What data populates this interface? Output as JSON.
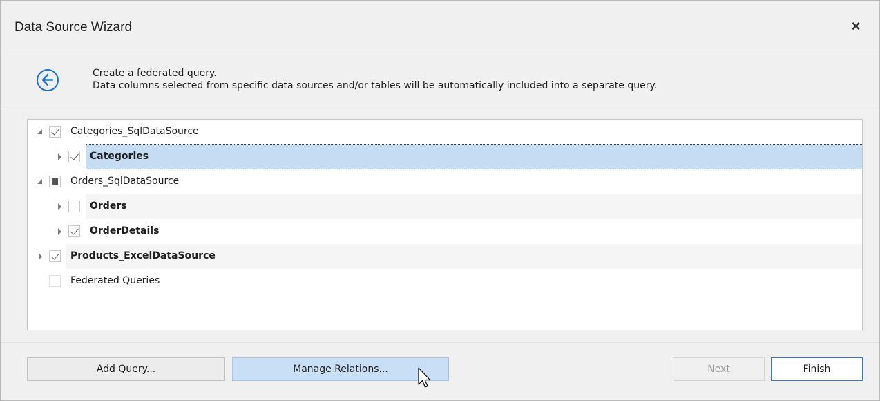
{
  "window": {
    "title": "Data Source Wizard",
    "close_glyph": "×"
  },
  "header": {
    "back_icon": "back-arrow-circle-icon",
    "accent_color": "#1a73d6",
    "line1": "Create a federated query.",
    "line2": "Data columns selected from specific data sources and/or tables will be automatically included into a separate query."
  },
  "tree": {
    "rows": [
      {
        "label": "Categories_SqlDataSource",
        "level": 0,
        "expander": "expanded",
        "check": "checked",
        "bold": false,
        "selected": false
      },
      {
        "label": "Categories",
        "level": 1,
        "expander": "collapsed",
        "check": "checked",
        "bold": true,
        "selected": true
      },
      {
        "label": "Orders_SqlDataSource",
        "level": 0,
        "expander": "expanded",
        "check": "indeterminate",
        "bold": false,
        "selected": false
      },
      {
        "label": "Orders",
        "level": 1,
        "expander": "collapsed",
        "check": "unchecked",
        "bold": true,
        "selected": false
      },
      {
        "label": "OrderDetails",
        "level": 1,
        "expander": "collapsed",
        "check": "checked",
        "bold": true,
        "selected": false
      },
      {
        "label": "Products_ExcelDataSource",
        "level": 0,
        "expander": "collapsed",
        "check": "checked",
        "bold": true,
        "selected": false
      },
      {
        "label": "Federated Queries",
        "level": 0,
        "expander": "none",
        "check": "disabled",
        "bold": false,
        "selected": false
      }
    ]
  },
  "buttons": {
    "add_query": "Add Query...",
    "manage_relations": "Manage Relations...",
    "next": "Next",
    "finish": "Finish"
  }
}
